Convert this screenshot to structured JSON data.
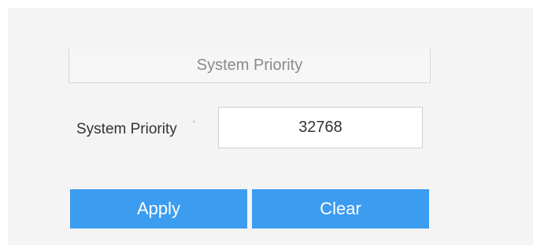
{
  "section": {
    "title": "System Priority"
  },
  "form": {
    "system_priority_label": "System Priority",
    "required_mark": "*",
    "system_priority_value": "32768"
  },
  "actions": {
    "apply_label": "Apply",
    "clear_label": "Clear"
  },
  "colors": {
    "button_bg": "#3c9cf0",
    "panel_bg": "#f4f4f4"
  }
}
